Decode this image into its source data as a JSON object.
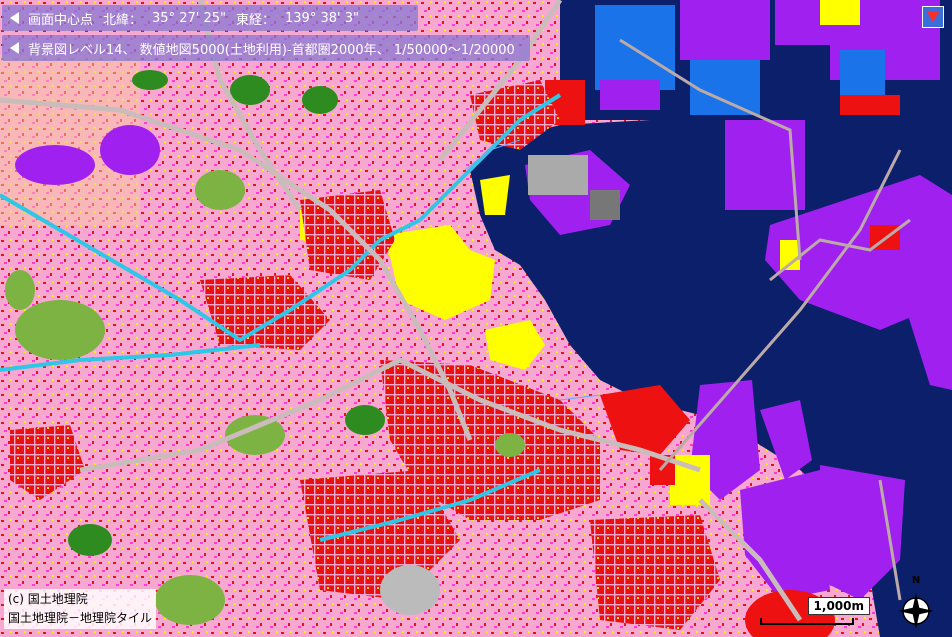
{
  "status": {
    "center_label": "画面中心点",
    "lat_label": "北緯：",
    "lat_value": "35° 27' 25\"",
    "lon_label": "東経：",
    "lon_value": "139° 38' 3\""
  },
  "layer": {
    "text": "背景図レベル14、 数値地図5000(土地利用)-首都圏2000年、 1/50000～1/20000"
  },
  "credit": {
    "line1": "(c) 国土地理院",
    "line2": "国土地理院－地理院タイル"
  },
  "scale": {
    "label": "1,000m"
  },
  "compass": {
    "north": "N"
  },
  "colors": {
    "sea": "#0c1f6b",
    "residential": "#f7a8d0",
    "commercial": "#ee1111",
    "industrial": "#a020f0",
    "public": "#ffff00",
    "forest": "#2e8b20",
    "park": "#7cb342",
    "river": "#2ec7e6",
    "road": "#c9b8b8"
  },
  "icons": {
    "collapse": "triangle-left-icon",
    "menu": "triangle-down-icon"
  }
}
